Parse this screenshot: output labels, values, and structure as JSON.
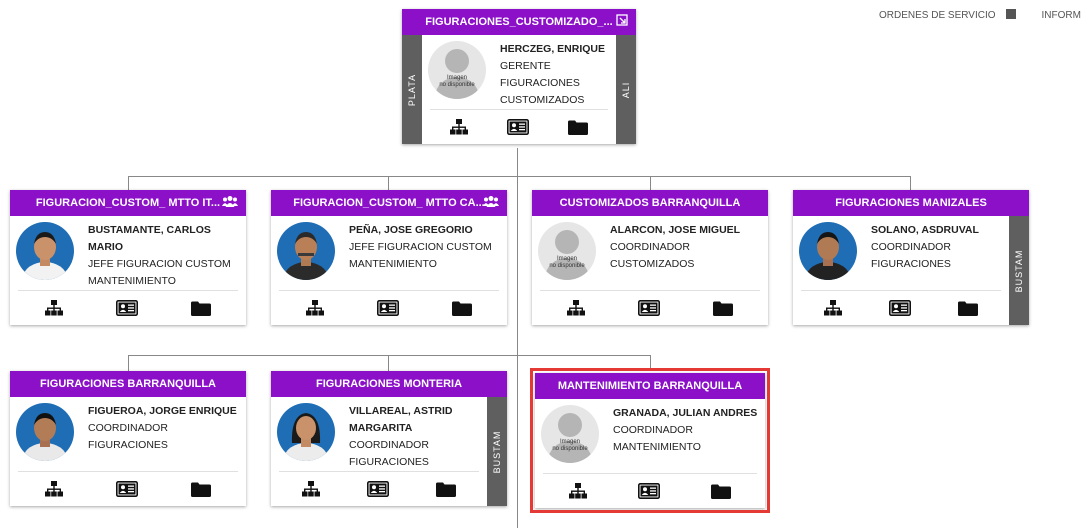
{
  "topnav": {
    "item1": "ORDENES DE SERVICIO",
    "item2": "INFORM"
  },
  "placeholder": {
    "line1": "Imagen",
    "line2": "no disponible"
  },
  "root": {
    "title": "FIGURACIONES_CUSTOMIZADO_...",
    "name": "HERCZEG, ENRIQUE",
    "role": "GERENTE",
    "dept": "FIGURACIONES CUSTOMIZADOS",
    "left_tab": "PLATA",
    "right_tab": "ALI"
  },
  "cards": [
    {
      "title": "FIGURACION_CUSTOM_ MTTO IT...",
      "name": "BUSTAMANTE, CARLOS MARIO",
      "role": "JEFE FIGURACION CUSTOM",
      "dept": "MANTENIMIENTO"
    },
    {
      "title": "FIGURACION_CUSTOM_ MTTO CA...",
      "name": "PEÑA, JOSE GREGORIO",
      "role": "JEFE FIGURACION CUSTOM",
      "dept": "MANTENIMIENTO"
    },
    {
      "title": "CUSTOMIZADOS BARRANQUILLA",
      "name": "ALARCON, JOSE MIGUEL",
      "role": "COORDINADOR",
      "dept": "CUSTOMIZADOS"
    },
    {
      "title": "FIGURACIONES MANIZALES",
      "name": "SOLANO, ASDRUVAL",
      "role": "COORDINADOR",
      "dept": "FIGURACIONES",
      "side": "BUSTAM"
    },
    {
      "title": "FIGURACIONES BARRANQUILLA",
      "name": "FIGUEROA, JORGE ENRIQUE",
      "role": "COORDINADOR",
      "dept": "FIGURACIONES"
    },
    {
      "title": "FIGURACIONES MONTERIA",
      "name": "VILLAREAL, ASTRID MARGARITA",
      "role": "COORDINADOR",
      "dept": "FIGURACIONES",
      "side": "BUSTAM"
    },
    {
      "title": "MANTENIMIENTO BARRANQUILLA",
      "name": "GRANADA, JULIAN ANDRES",
      "role": "COORDINADOR",
      "dept": "MANTENIMIENTO"
    }
  ],
  "icons": {
    "org": "org-chart-icon",
    "card": "id-card-icon",
    "folder": "folder-icon",
    "group": "group-icon",
    "expand": "expand-icon"
  },
  "colors": {
    "header": "#8b10c8",
    "side_tab": "#5f5f5f",
    "selection": "#e53935"
  }
}
